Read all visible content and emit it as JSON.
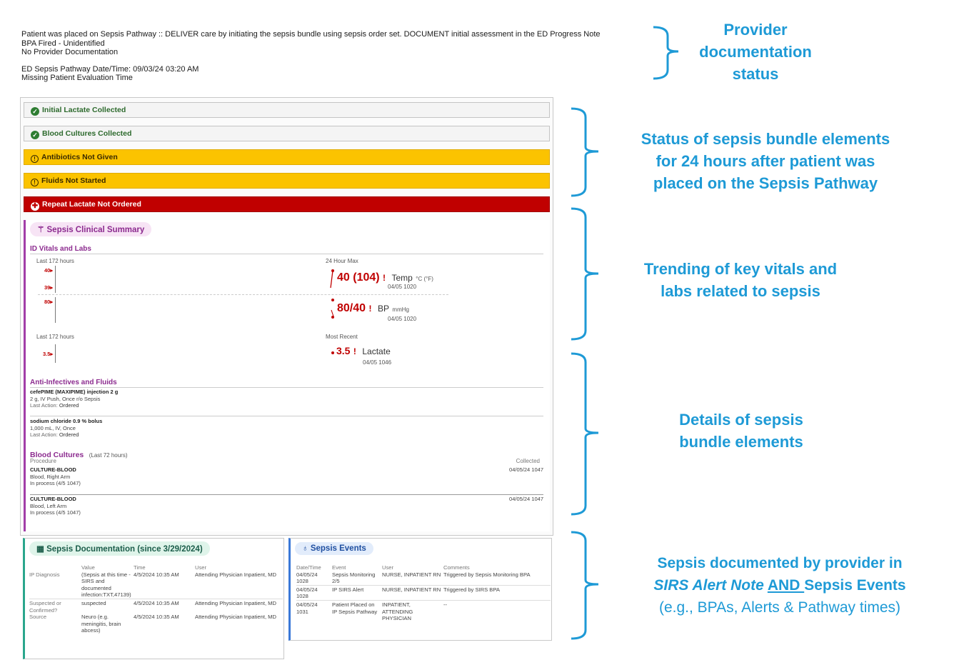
{
  "header": {
    "line1": "Patient was placed on Sepsis Pathway :: DELIVER care by initiating the sepsis bundle using sepsis order set. DOCUMENT initial assessment in the ED Progress Note",
    "line2": "BPA Fired - Unidentified",
    "line3": "No Provider Documentation",
    "line4": "ED Sepsis Pathway Date/Time: 09/03/24 03:20 AM",
    "line5": "Missing Patient Evaluation Time"
  },
  "annotations": {
    "a1": [
      "Provider",
      "documentation",
      "status"
    ],
    "a2": [
      "Status of sepsis bundle elements",
      "for 24 hours after patient was",
      "placed on the Sepsis Pathway"
    ],
    "a3": [
      "Trending of key vitals and",
      "labs related to sepsis"
    ],
    "a4": [
      "Details of sepsis",
      "bundle elements"
    ],
    "a5_line1": "Sepsis documented by provider in",
    "a5_italic": "SIRS Alert Note",
    "a5_underline": "AND ",
    "a5_tail": "Sepsis Events",
    "a5_line3": "(e.g., BPAs, Alerts & Pathway times)",
    "color": "#1e9ad6"
  },
  "bundle_status": [
    {
      "label": "Initial Lactate Collected",
      "state": "ok",
      "icon": "check-circle-icon"
    },
    {
      "label": "Blood Cultures Collected",
      "state": "ok",
      "icon": "check-circle-icon"
    },
    {
      "label": "Antibiotics Not Given",
      "state": "warn",
      "icon": "exclamation-circle-icon"
    },
    {
      "label": "Fluids Not Started",
      "state": "warn",
      "icon": "exclamation-circle-icon"
    },
    {
      "label": "Repeat Lactate Not Ordered",
      "state": "err",
      "icon": "alert-cross-icon"
    }
  ],
  "summary": {
    "title": "Sepsis Clinical Summary",
    "vitals_title": "ID Vitals and Labs",
    "last172": "Last 172 hours",
    "max24": "24 Hour Max",
    "most_recent": "Most Recent",
    "tick_40": "40",
    "tick_39": "39",
    "tick_80": "80",
    "tick_35": "3.5",
    "temp_value": "40 (104)",
    "temp_label": "Temp",
    "temp_unit": "°C (°F)",
    "temp_time": "04/05 1020",
    "bp_value": "80/40",
    "bp_label": "BP",
    "bp_unit": "mmHg",
    "bp_time": "04/05 1020",
    "lac_value": "3.5",
    "lac_label": "Lactate",
    "lac_time": "04/05 1046",
    "abnormal_mark": "!",
    "anti_title": "Anti-Infectives and Fluids",
    "med1_name": "cefePIME (MAXIPIME) injection 2 g",
    "med1_detail": "2 g, IV Push, Once r/o Sepsis",
    "med1_action_label": "Last Action:",
    "med1_action": "Ordered",
    "med2_name": "sodium chloride 0.9 % bolus",
    "med2_detail": "1,000 mL, IV, Once",
    "med2_action_label": "Last Action:",
    "med2_action": "Ordered",
    "bc_title": "Blood Cultures",
    "bc_sub": "(Last 72 hours)",
    "bc_col_proc": "Procedure",
    "bc_col_collected": "Collected",
    "bc_rows": [
      {
        "name": "CULTURE-BLOOD",
        "site": "Blood, Right Arm",
        "status": "In process (4/5 1047)",
        "collected": "04/05/24 1047"
      },
      {
        "name": "CULTURE-BLOOD",
        "site": "Blood, Left Arm",
        "status": "In process (4/5 1047)",
        "collected": "04/05/24 1047"
      }
    ]
  },
  "documentation": {
    "title": "Sepsis Documentation (since 3/29/2024)",
    "headers": [
      "",
      "Value",
      "Time",
      "User"
    ],
    "rows": [
      {
        "field": "IP Diagnosis",
        "value": "(Sepsis at this time - SIRS and documented infection:TXT,47139)",
        "time": "4/5/2024 10:35 AM",
        "user": "Attending Physician Inpatient, MD"
      },
      {
        "field": "Suspected or Confirmed?",
        "value": "suspected",
        "time": "4/5/2024 10:35 AM",
        "user": "Attending Physician Inpatient, MD"
      },
      {
        "field": "Source",
        "value": "Neuro (e.g. meningitis, brain abcess)",
        "time": "4/5/2024 10:35 AM",
        "user": "Attending Physician Inpatient, MD"
      }
    ]
  },
  "events": {
    "title": "Sepsis Events",
    "headers": [
      "Date/Time",
      "Event",
      "User",
      "Comments"
    ],
    "rows": [
      {
        "dt": "04/05/24 1028",
        "event": "Sepsis Monitoring 2/5",
        "user": "NURSE, INPATIENT RN",
        "comment": "Triggered by Sepsis Monitoring BPA"
      },
      {
        "dt": "04/05/24 1028",
        "event": "IP SIRS Alert",
        "user": "NURSE, INPATIENT RN",
        "comment": "Triggered by SIRS BPA"
      },
      {
        "dt": "04/05/24 1031",
        "event": "Patient Placed on IP Sepsis Pathway",
        "user": "INPATIENT, ATTENDING PHYSICIAN",
        "comment": "--"
      }
    ]
  },
  "colors": {
    "ok": "#2d6a2d",
    "warn": "#fbc300",
    "err": "#c00000",
    "accent_purple": "#a23fa8",
    "accent_green": "#2aa68c",
    "accent_blue": "#3a78d8"
  }
}
